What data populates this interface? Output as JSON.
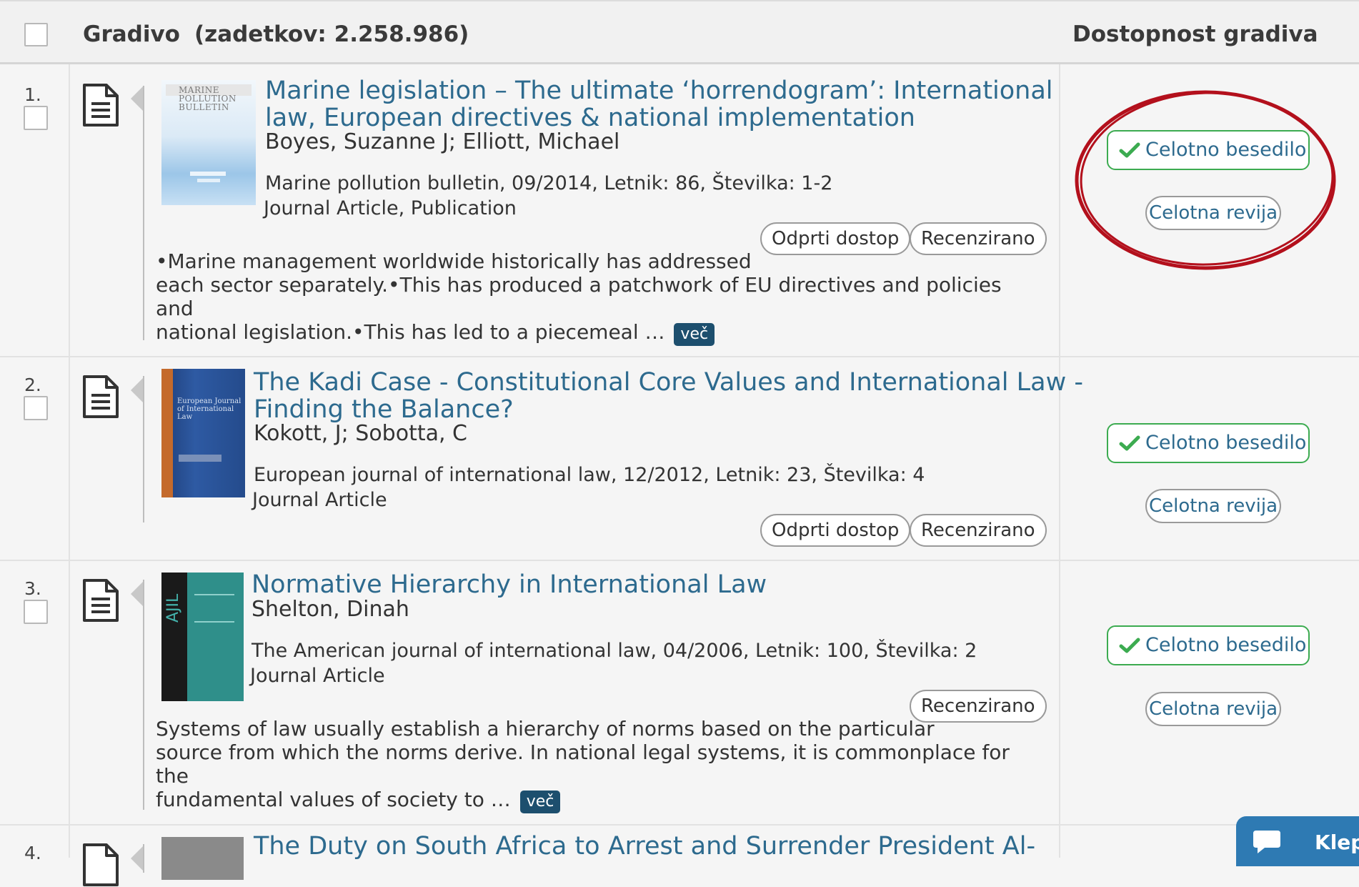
{
  "header": {
    "title": "Gradivo",
    "count": "(zadetkov: 2.258.986)",
    "availability": "Dostopnost gradiva"
  },
  "results": [
    {
      "number": "1.",
      "title_line1": "Marine legislation – The ultimate ‘horrendogram’: International",
      "title_line2": "law, European directives & national implementation",
      "authors": "Boyes, Suzanne J; Elliott, Michael",
      "source": "Marine pollution bulletin, 09/2014, Letnik: 86, Številka: 1-2",
      "type": "Journal Article, Publication",
      "tag_open": "Odprti dostop",
      "tag_reviewed": "Recenzirano",
      "abstract_line1": "•Marine management worldwide historically has addressed",
      "abstract_line2": "each sector separately.•This has produced a patchwork of EU directives and policies and",
      "abstract_line3": "national legislation.•This has led to a piecemeal …",
      "more": "več",
      "cover_text": "MARINE POLLUTION BULLETIN",
      "full_text": "Celotno besedilo",
      "full_journal": "Celotna revija"
    },
    {
      "number": "2.",
      "title_line1": "The Kadi Case - Constitutional Core Values and International Law -",
      "title_line2": "Finding the Balance?",
      "authors": "Kokott, J; Sobotta, C",
      "source": "European journal of international law, 12/2012, Letnik: 23, Številka: 4",
      "type": "Journal Article",
      "tag_open": "Odprti dostop",
      "tag_reviewed": "Recenzirano",
      "cover_text": "European Journal of International Law",
      "full_text": "Celotno besedilo",
      "full_journal": "Celotna revija"
    },
    {
      "number": "3.",
      "title_line1": "Normative Hierarchy in International Law",
      "authors": "Shelton, Dinah",
      "source": "The American journal of international law, 04/2006, Letnik: 100, Številka: 2",
      "type": "Journal Article",
      "tag_reviewed": "Recenzirano",
      "abstract_line1": "Systems of law usually establish a hierarchy of norms based on the particular",
      "abstract_line2": "source from which the norms derive. In national legal systems, it is commonplace for the",
      "abstract_line3": "fundamental values of society to …",
      "more": "več",
      "cover_text": "AJIL",
      "full_text": "Celotno besedilo",
      "full_journal": "Celotna revija"
    },
    {
      "number": "4.",
      "title_line1": "The Duty on South Africa to Arrest and Surrender President Al-"
    }
  ],
  "chat": {
    "label": "Klep"
  },
  "colors": {
    "link": "#2d6a8e",
    "accent_green": "#3cab50",
    "highlight_red": "#b3101c",
    "badge_dark": "#1d4f6e",
    "chat_blue": "#2e7ab3"
  }
}
